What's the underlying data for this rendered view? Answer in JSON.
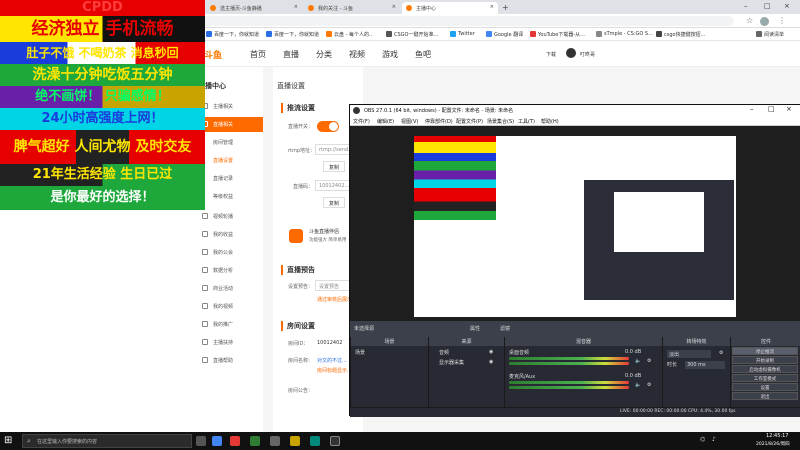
{
  "browser": {
    "tabs": [
      {
        "label": "选主播页-斗鱼静播"
      },
      {
        "label": "我的关注 - 斗鱼"
      },
      {
        "label": "主播中心",
        "active": true
      }
    ],
    "new_tab": "+",
    "url": "",
    "bookmarks": [
      {
        "label": "百度一下，你就知道",
        "color": "#2b6fe7"
      },
      {
        "label": "百度一下，你就知道",
        "color": "#2b6fe7"
      },
      {
        "label": "云盘 - 每个人的..",
        "color": "#ff7a00"
      },
      {
        "label": "CSGO一键开始准...",
        "color": "#555555"
      },
      {
        "label": "Twitter",
        "color": "#1da1f2"
      },
      {
        "label": "Google 翻译",
        "color": "#4285f4"
      },
      {
        "label": "YouTube下载器-从...",
        "color": "#e53935"
      },
      {
        "label": "sTmple - CS:GO S...",
        "color": "#888888"
      },
      {
        "label": "csgo快捷键按钮...",
        "color": "#444444"
      },
      {
        "label": "阅读清单",
        "color": "#666666"
      }
    ]
  },
  "site": {
    "logo": "斗鱼",
    "nav": [
      "首页",
      "直播",
      "分类",
      "视频",
      "游戏",
      "鱼吧"
    ],
    "download": "下载",
    "username": "叮咚哥"
  },
  "sidebar": {
    "title": "播中心",
    "items": [
      {
        "label": "主播相关"
      },
      {
        "label": "直播相关",
        "active": true
      },
      {
        "label": "房间管理"
      },
      {
        "label": "直播设置"
      },
      {
        "label": "直播记录"
      },
      {
        "label": "等级权益"
      },
      {
        "label": "视频轮播"
      },
      {
        "label": "我的收益"
      },
      {
        "label": "我的公会"
      },
      {
        "label": "数据分析"
      },
      {
        "label": "商业活动"
      },
      {
        "label": "我的视频"
      },
      {
        "label": "我的推广"
      },
      {
        "label": "主播扶持"
      },
      {
        "label": "直播帮助"
      }
    ]
  },
  "main": {
    "header": "直播设置",
    "stream_section": "推流设置",
    "live_switch_label": "直播开关：",
    "rtmp_label": "rtmp地址：",
    "rtmp_value": "rtmp://send...",
    "copy1": "复制",
    "code_label": "直播码：",
    "code_value": "10012402...",
    "copy2": "复制",
    "promo": "斗鱼直播伴侣",
    "promo_sub": "功能强大 简单易用",
    "notice_section": "直播预告",
    "notice_label": "设置预告：",
    "notice_value": "设置预告",
    "notice_tip": "通过审核后展示",
    "room_section": "房间设置",
    "room_id_label": "房间ID：",
    "room_id": "10012402",
    "room_name_label": "房间名称：",
    "room_name_tip": "对文的不过...",
    "room_name_tip2": "房间标题显示...",
    "room_notice_label": "房间公告："
  },
  "ad": {
    "lines": [
      {
        "text": "CPDD",
        "bg": "#e60000",
        "fg": "#ff3d3d"
      },
      {
        "text": "经济独立  手机流畅",
        "bg": "#ffe600",
        "fg": "#e60000"
      },
      {
        "text": "肚子不饿  不喝奶茶  消息秒回",
        "bg": "#1a3cdc",
        "fg": "#ffffff"
      },
      {
        "text": "洗澡十分钟吃饭五分钟",
        "bg": "#1ea83c",
        "fg": "#ffe600"
      },
      {
        "text": "绝不画饼！  只骗感情！",
        "bg": "#6a1fa8",
        "fg": "#00ff66"
      },
      {
        "text": "24小时高强度上网！",
        "bg": "#00d5e6",
        "fg": "#1a3cdc"
      },
      {
        "text": "脾气超好  人间尤物  及时交友",
        "bg": "#e60000",
        "fg": "#ffe600"
      },
      {
        "text": "21年生活经验  生日已过",
        "bg": "#222222",
        "fg": "#ffe600"
      },
      {
        "text": "是你最好的选择！",
        "bg": "#1ea83c",
        "fg": "#ffffff"
      }
    ]
  },
  "obs": {
    "title": "OBS 27.0.1 (64 bit, windows) - 配置文件: 未命名 - 场景: 未命名",
    "menu": [
      "文件(F)",
      "编辑(E)",
      "视图(V)",
      "停靠部件(D)",
      "配置文件(P)",
      "场景集合(S)",
      "工具(T)",
      "帮助(H)"
    ],
    "scenes_title": "未选择源",
    "scene": "场景",
    "scenes_dock": "场景",
    "sources_dock": "来源",
    "sources": [
      "音频",
      "显示器采集"
    ],
    "mixer_dock": "混音器",
    "mixer": [
      {
        "name": "桌面音频",
        "level": "0.0 dB"
      },
      {
        "name": "麦克风/Aux",
        "level": "0.0 dB"
      }
    ],
    "transition_dock": "转场特效",
    "transition": "淡出",
    "duration_label": "时长",
    "duration": "300 ms",
    "controls_dock": "控件",
    "buttons": [
      "停止推流",
      "开始录制",
      "启动虚拟摄像机",
      "工作室模式",
      "设置",
      "退出"
    ],
    "status": "LIVE: 00:00:00    REC: 00:00:00    CPU: 4.4%, 30.00 fps",
    "attr_btn": "属性",
    "filter_btn": "滤镜"
  },
  "taskbar": {
    "search": "在这里输入你要搜索的内容",
    "time": "12:45:17",
    "date": "2021/8/26/周四"
  }
}
